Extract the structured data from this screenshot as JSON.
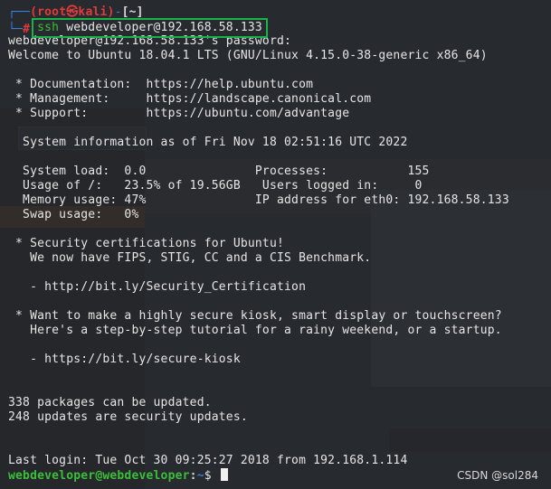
{
  "prompt": {
    "corner_top": "┌──",
    "user_host": "(root㉿kali)",
    "dash": "-",
    "path": "[~]",
    "corner_bottom": "└─",
    "hash": "#",
    "command_program": "ssh",
    "command_args": " webdeveloper@192.168.58.133"
  },
  "login": {
    "password_line": "webdeveloper@192.168.58.133's password:",
    "welcome_line": "Welcome to Ubuntu 18.04.1 LTS (GNU/Linux 4.15.0-38-generic x86_64)"
  },
  "links": {
    "documentation": " * Documentation:  https://help.ubuntu.com",
    "management": " * Management:     https://landscape.canonical.com",
    "support": " * Support:        https://ubuntu.com/advantage"
  },
  "sysinfo": {
    "header": "  System information as of Fri Nov 18 02:51:16 UTC 2022",
    "row1": "  System load:  0.0               Processes:           155",
    "row2": "  Usage of /:   23.5% of 19.56GB   Users logged in:     0",
    "row3": "  Memory usage: 47%               IP address for eth0: 192.168.58.133",
    "row4": "  Swap usage:   0%"
  },
  "security": {
    "line1": " * Security certifications for Ubuntu!",
    "line2": "   We now have FIPS, STIG, CC and a CIS Benchmark.",
    "link": "   - http://bit.ly/Security_Certification"
  },
  "kiosk": {
    "line1": " * Want to make a highly secure kiosk, smart display or touchscreen?",
    "line2": "   Here's a step-by-step tutorial for a rainy weekend, or a startup.",
    "link": "   - https://bit.ly/secure-kiosk"
  },
  "updates": {
    "packages": "338 packages can be updated.",
    "security": "248 updates are security updates."
  },
  "last_login": "Last login: Tue Oct 30 09:25:27 2018 from 192.168.1.114",
  "remote_prompt": {
    "user_host": "webdeveloper@webdeveloper",
    "separator": ":",
    "path": "~",
    "symbol": "$ "
  },
  "watermark": "CSDN @sol284",
  "colors": {
    "highlight_box": "#19b34a",
    "prompt_green": "#3bbf3b",
    "prompt_red": "#e03b3b",
    "prompt_blue": "#3b7de0"
  }
}
